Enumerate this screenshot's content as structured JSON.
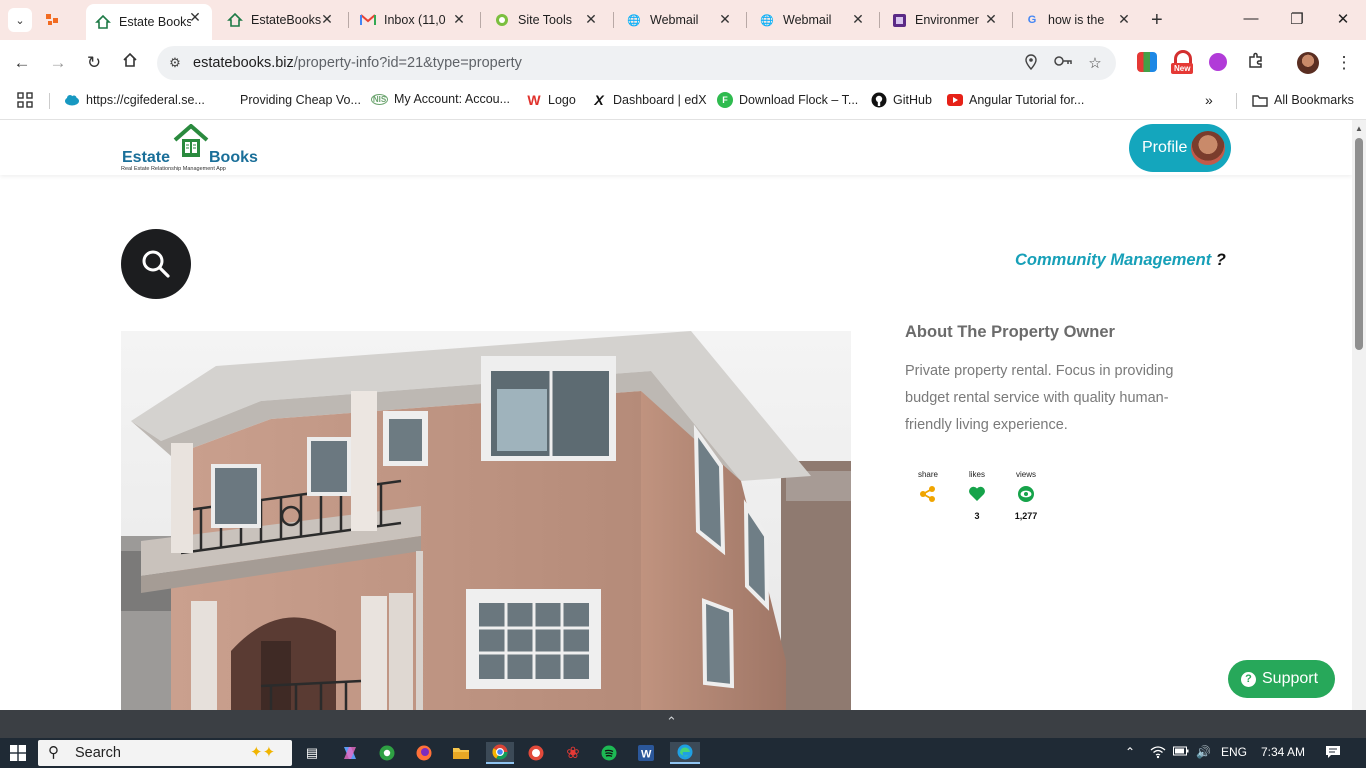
{
  "browser": {
    "tabs": [
      {
        "title": "",
        "favicon": "orange-puzzle",
        "active": false
      },
      {
        "title": "Estate Books",
        "favicon": "house-icon",
        "active": true
      },
      {
        "title": "EstateBooks",
        "favicon": "house-icon",
        "active": false
      },
      {
        "title": "Inbox (11,0",
        "favicon": "gmail-icon",
        "active": false
      },
      {
        "title": "Site Tools",
        "favicon": "site-tools-icon",
        "active": false
      },
      {
        "title": "Webmail",
        "favicon": "globe-icon",
        "active": false
      },
      {
        "title": "Webmail",
        "favicon": "globe-icon",
        "active": false
      },
      {
        "title": "Environmer",
        "favicon": "purple-square-icon",
        "active": false
      },
      {
        "title": "how is the",
        "favicon": "google-icon",
        "active": false
      }
    ],
    "url": {
      "host": "estatebooks.biz",
      "path": "/property-info?id=21&type=property"
    },
    "extension_badge": "New",
    "bookmarks": [
      {
        "label": "https://cgifederal.se...",
        "icon": "salesforce-cloud-icon",
        "color": "#1798c1"
      },
      {
        "label": "Providing Cheap Vo...",
        "icon": "blank-icon",
        "color": "#ffffff"
      },
      {
        "label": "My Account: Accou...",
        "icon": "nis-icon",
        "color": "#6aa36d"
      },
      {
        "label": "Logo",
        "icon": "w-logo-icon",
        "color": "#e0322c"
      },
      {
        "label": "Dashboard | edX",
        "icon": "edx-icon",
        "color": "#111111"
      },
      {
        "label": "Download Flock – T...",
        "icon": "flock-icon",
        "color": "#2fbb4f"
      },
      {
        "label": "GitHub",
        "icon": "github-icon",
        "color": "#111111"
      },
      {
        "label": "Angular Tutorial for...",
        "icon": "youtube-icon",
        "color": "#e62117"
      }
    ],
    "all_bookmarks": "All Bookmarks"
  },
  "header": {
    "logo_word1": "Estate",
    "logo_word2": "Books",
    "logo_tagline": "Real Estate Relationship Management App",
    "profile_label": "Profile"
  },
  "main": {
    "community_link": "Community Management",
    "community_suffix": "?",
    "about_title": "About The Property Owner",
    "about_text": "Private property rental. Focus in providing budget rental service with quality human-friendly living experience.",
    "stats": [
      {
        "label": "share",
        "icon": "share-icon",
        "color": "#f0a500",
        "value": ""
      },
      {
        "label": "likes",
        "icon": "heart-icon",
        "color": "#16a34a",
        "value": "3"
      },
      {
        "label": "views",
        "icon": "eye-icon",
        "color": "#16a34a",
        "value": "1,277"
      }
    ],
    "support_label": "Support"
  },
  "taskbar": {
    "search_label": "Search",
    "language": "ENG",
    "time": "7:34 AM"
  }
}
